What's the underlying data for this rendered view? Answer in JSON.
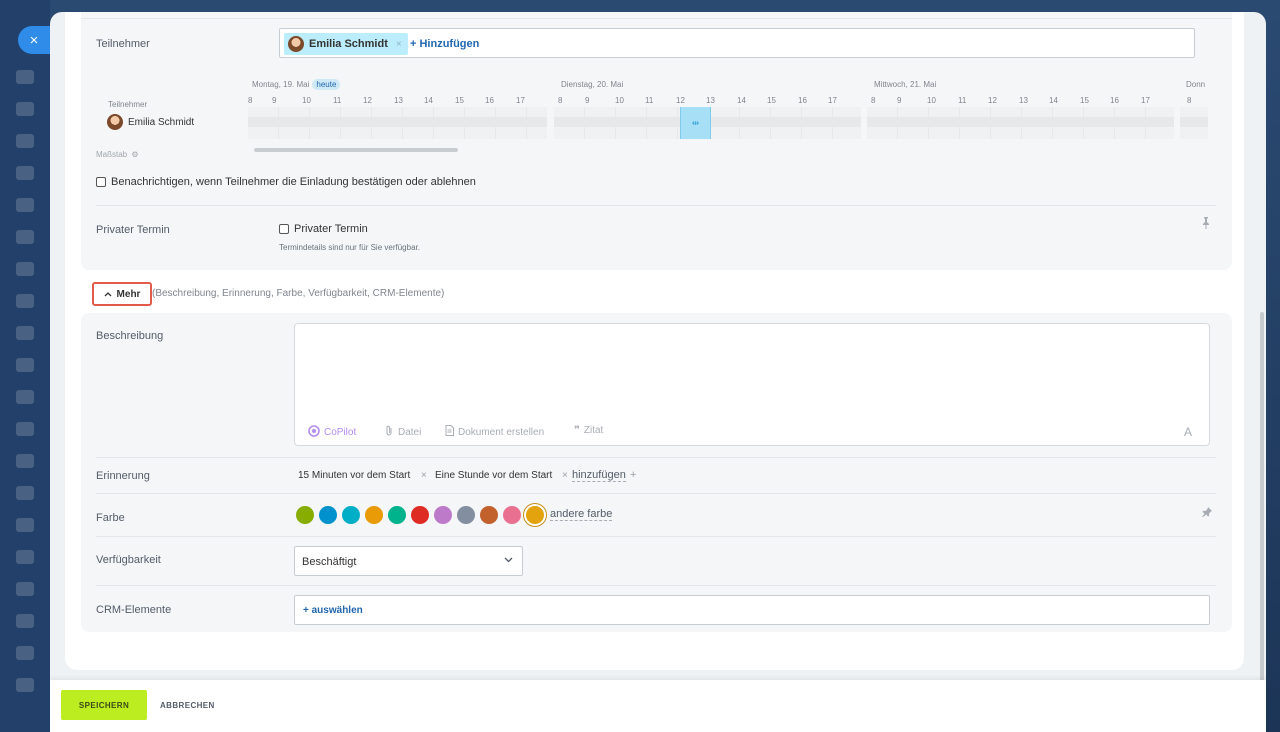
{
  "participants": {
    "label": "Teilnehmer",
    "chip_name": "Emilia Schmidt",
    "chip_remove": "×",
    "add_label": "+ Hinzufügen"
  },
  "timeline": {
    "row_header": "Teilnehmer",
    "participant_name": "Emilia Schmidt",
    "scale_label": "Maßstab",
    "today_badge": "heute",
    "days": [
      {
        "label": "Montag, 19. Mai"
      },
      {
        "label": "Dienstag, 20. Mai"
      },
      {
        "label": "Mittwoch, 21. Mai"
      },
      {
        "label": "Donn"
      }
    ],
    "hours": [
      "8",
      "9",
      "10",
      "11",
      "12",
      "13",
      "14",
      "15",
      "16",
      "17"
    ],
    "busy_icon": "⇹"
  },
  "notify": {
    "label": "Benachrichtigen, wenn Teilnehmer die Einladung bestätigen oder ablehnen"
  },
  "private": {
    "label": "Privater Termin",
    "checkbox_label": "Privater Termin",
    "hint": "Termindetails sind nur für Sie verfügbar."
  },
  "more": {
    "button_label": "Mehr",
    "hint": "(Beschreibung, Erinnerung, Farbe, Verfügbarkeit, CRM-Elemente)"
  },
  "description": {
    "label": "Beschreibung",
    "tools": {
      "copilot": "CoPilot",
      "file": "Datei",
      "document": "Dokument erstellen",
      "quote": "Zitat",
      "format": "A"
    }
  },
  "reminder": {
    "label": "Erinnerung",
    "items": [
      "15 Minuten vor dem Start",
      "Eine Stunde vor dem Start"
    ],
    "add_label": "hinzufügen",
    "remove": "×",
    "plus": "+"
  },
  "color": {
    "label": "Farbe",
    "swatches": [
      "#86ad00",
      "#0092cc",
      "#00afc7",
      "#e89b06",
      "#00b38c",
      "#de2b24",
      "#bd7ac9",
      "#838fa0",
      "#c3612c",
      "#e97090",
      "#e2a30f"
    ],
    "other_label": "andere farbe"
  },
  "availability": {
    "label": "Verfügbarkeit",
    "value": "Beschäftigt",
    "arrow": "⌄"
  },
  "crm": {
    "label": "CRM-Elemente",
    "select_label": "+ auswählen"
  },
  "footer": {
    "save_label": "SPEICHERN",
    "cancel_label": "ABBRECHEN"
  },
  "icons": {
    "close": "×",
    "gear": "⚙",
    "pin": "📌",
    "chevron_up": "^"
  }
}
